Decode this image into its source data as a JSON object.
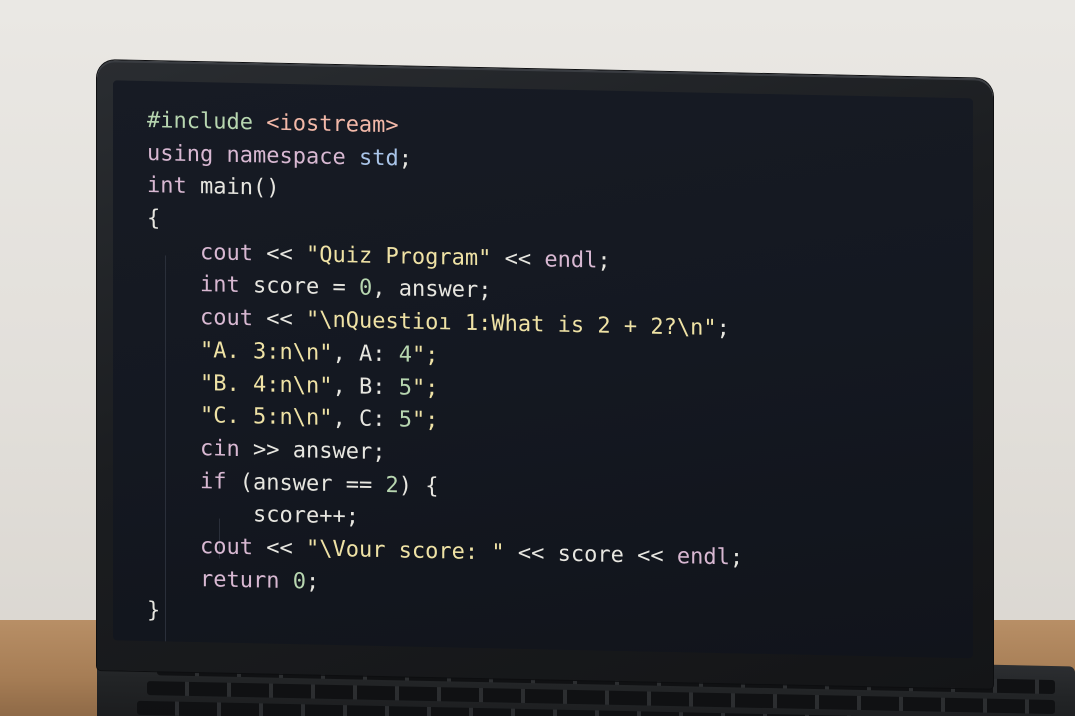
{
  "scene": {
    "desk_color": "#a67d55",
    "wall_color": "#e6e3df",
    "bezel_color": "#1b1d20",
    "screen_bg": "#141821"
  },
  "code": {
    "language": "cpp",
    "lines": [
      "#include <iostream>",
      "using namespace std;",
      "int main()",
      "{",
      "    cout << \"Quiz Program\" << endl;",
      "    int score = 0, answer;",
      "    cout << \"\\nQuestioı 1:What is 2 + 2?\\n\";",
      "    \"A. 3:n\\n\", A: 4\";",
      "    \"B. 4:n\\n\", B: 5\";",
      "    \"C. 5:n\\n\", C: 5\";",
      "    cin >> answer;",
      "    if (answer == 2) {",
      "        score++;",
      "    cout << \"\\Vour score: \" << score << endl;",
      "    return 0;",
      "}"
    ]
  },
  "syntax_colors": {
    "keyword": "#d8b8d2",
    "string": "#efe2a5",
    "number": "#b7d6b0",
    "header": "#f2b8a8",
    "namespace": "#a9c4e8",
    "plain": "#e7e6e0"
  }
}
